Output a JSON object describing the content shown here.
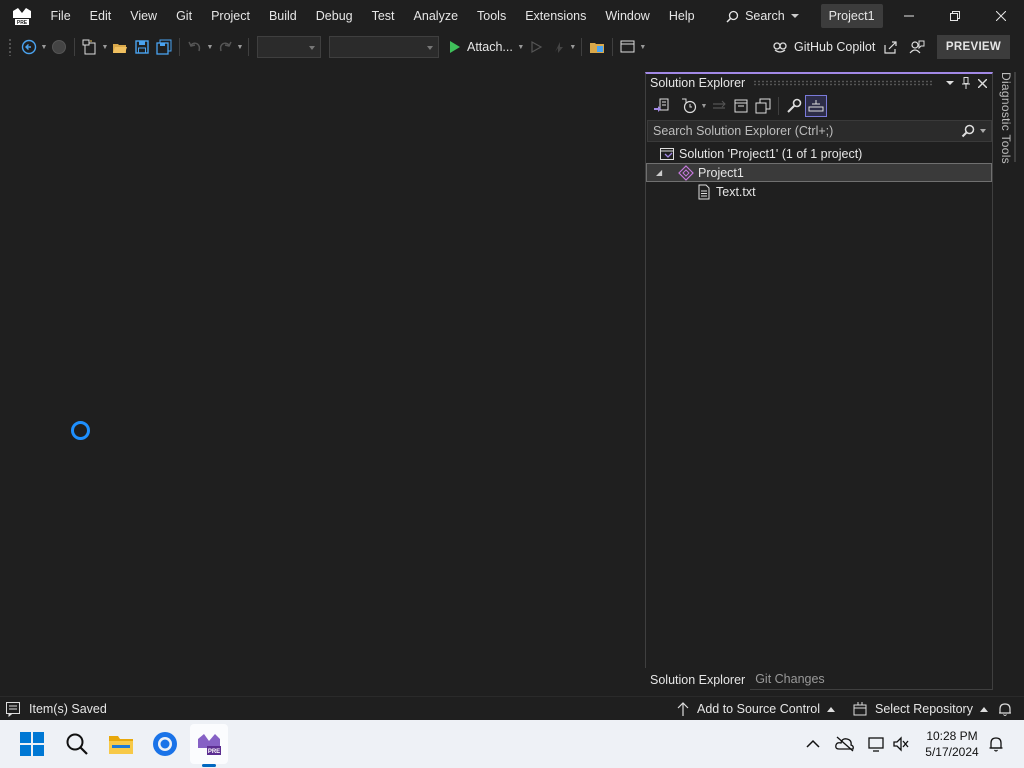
{
  "menu": {
    "items": [
      "File",
      "Edit",
      "View",
      "Git",
      "Project",
      "Build",
      "Debug",
      "Test",
      "Analyze",
      "Tools",
      "Extensions",
      "Window",
      "Help"
    ],
    "search_label": "Search",
    "project_badge": "Project1"
  },
  "toolbar": {
    "attach_label": "Attach...",
    "copilot_label": "GitHub Copilot",
    "preview_label": "PREVIEW"
  },
  "solution_explorer": {
    "title": "Solution Explorer",
    "search_placeholder": "Search Solution Explorer (Ctrl+;)",
    "tree": {
      "solution": "Solution 'Project1' (1 of 1 project)",
      "project": "Project1",
      "file": "Text.txt"
    },
    "tabs": [
      "Solution Explorer",
      "Git Changes"
    ]
  },
  "side_panel": {
    "diagnostic_label": "Diagnostic Tools"
  },
  "status": {
    "left_text": "Item(s) Saved",
    "source_control": "Add to Source Control",
    "repository": "Select Repository"
  },
  "taskbar": {
    "time": "10:28 PM",
    "date": "5/17/2024"
  },
  "colors": {
    "background": "#1f1f1f",
    "accent_purple": "#a289e6",
    "spinner_blue": "#1e90ff",
    "taskbar_bg": "#eef1f6"
  }
}
